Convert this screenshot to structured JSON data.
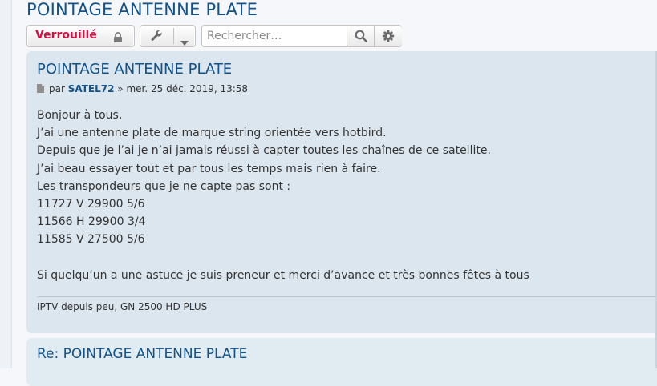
{
  "topic": {
    "title": "POINTAGE ANTENNE PLATE"
  },
  "actions": {
    "locked_label": "Verrouillé",
    "search_placeholder": "Rechercher…"
  },
  "posts": [
    {
      "title": "POINTAGE ANTENNE PLATE",
      "byline": {
        "prefix": "par",
        "author": "SATEL72",
        "date": "» mer. 25 déc. 2019, 13:58"
      },
      "content": [
        "Bonjour à tous,",
        "J’ai une antenne plate de marque string orientée vers hotbird.",
        "Depuis que je l’ai je n’ai jamais réussi à capter toutes les chaînes de ce satellite.",
        "J’ai beau essayer tout et par tous les temps mais rien à faire.",
        "Les transpondeurs que je ne capte pas sont :",
        "11727 V 29900 5/6",
        "11566 H 29900 3/4",
        "11585 V 27500 5/6",
        "",
        "Si quelqu’un a une astuce je suis preneur et merci d’avance et très bonnes fêtes à tous"
      ],
      "signature": "IPTV depuis peu, GN 2500 HD PLUS"
    },
    {
      "title": "Re: POINTAGE ANTENNE PLATE"
    }
  ],
  "colors": {
    "link": "#105289",
    "locked": "#d31141",
    "post_bg": "#dce6ee"
  }
}
